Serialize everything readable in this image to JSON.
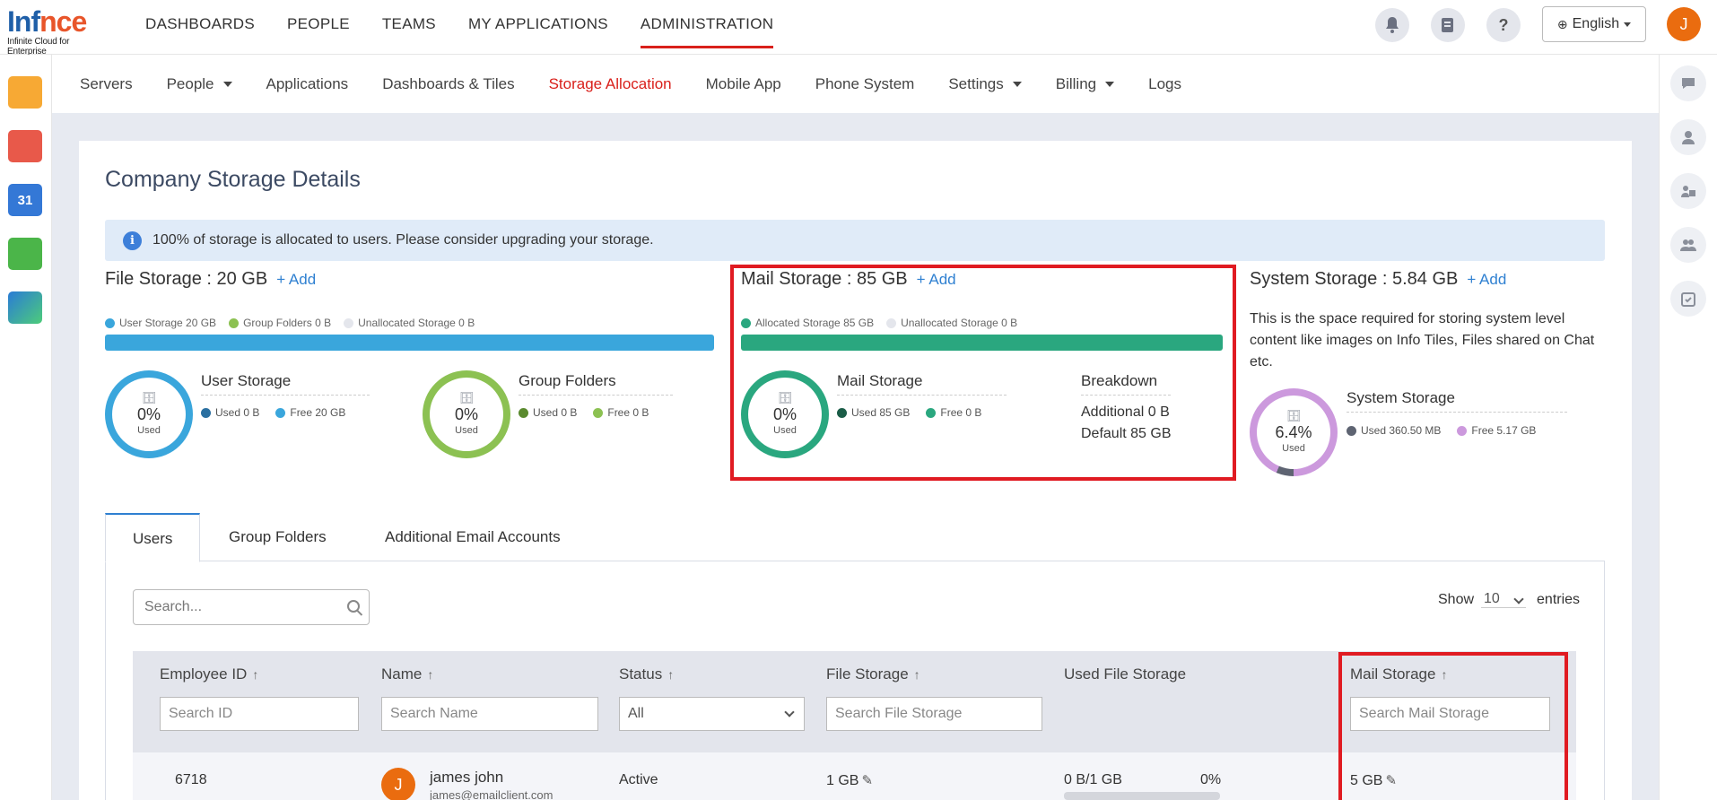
{
  "logo": {
    "name": "Infince",
    "name_a": "Inf",
    "name_b": "nce",
    "tagline": "Infinite Cloud for Enterprise"
  },
  "topnav": [
    "DASHBOARDS",
    "PEOPLE",
    "TEAMS",
    "MY APPLICATIONS",
    "ADMINISTRATION"
  ],
  "topnav_active": "ADMINISTRATION",
  "language": "English",
  "user_initial": "J",
  "subnav": [
    {
      "label": "Servers",
      "dropdown": false
    },
    {
      "label": "People",
      "dropdown": true
    },
    {
      "label": "Applications",
      "dropdown": false
    },
    {
      "label": "Dashboards & Tiles",
      "dropdown": false
    },
    {
      "label": "Storage Allocation",
      "dropdown": false,
      "active": true
    },
    {
      "label": "Mobile App",
      "dropdown": false
    },
    {
      "label": "Phone System",
      "dropdown": false
    },
    {
      "label": "Settings",
      "dropdown": true
    },
    {
      "label": "Billing",
      "dropdown": true
    },
    {
      "label": "Logs",
      "dropdown": false
    }
  ],
  "page_title": "Company Storage Details",
  "alert": "100% of storage is allocated to users. Please consider upgrading your storage.",
  "add_label": "+ Add",
  "file_storage": {
    "title": "File Storage : 20 GB",
    "legend": [
      "User Storage 20 GB",
      "Group Folders 0 B",
      "Unallocated Storage 0 B"
    ],
    "user": {
      "title": "User Storage",
      "pct": "0%",
      "used_label": "Used",
      "used": "Used 0 B",
      "free": "Free 20 GB",
      "used_fraction": 0
    },
    "group": {
      "title": "Group Folders",
      "pct": "0%",
      "used_label": "Used",
      "used": "Used 0 B",
      "free": "Free 0 B",
      "used_fraction": 0
    }
  },
  "mail_storage": {
    "title": "Mail Storage : 85 GB",
    "legend": [
      "Allocated Storage 85 GB",
      "Unallocated Storage 0 B"
    ],
    "donut": {
      "title": "Mail Storage",
      "pct": "0%",
      "used_label": "Used",
      "used": "Used 85 GB",
      "free": "Free 0 B",
      "used_fraction": 0
    },
    "breakdown_title": "Breakdown",
    "breakdown": [
      "Additional 0 B",
      "Default 85 GB"
    ]
  },
  "system_storage": {
    "title": "System Storage : 5.84 GB",
    "description": "This is the space required for storing system level content like images on Info Tiles, Files shared on Chat etc.",
    "donut": {
      "title": "System Storage",
      "pct": "6.4%",
      "used_label": "Used",
      "used": "Used 360.50 MB",
      "free": "Free 5.17 GB",
      "used_fraction": 0.064
    }
  },
  "tabs": [
    "Users",
    "Group Folders",
    "Additional Email Accounts"
  ],
  "search_placeholder": "Search...",
  "show": {
    "label": "Show",
    "value": "10",
    "suffix": "entries"
  },
  "columns": {
    "employee_id": "Employee ID",
    "name": "Name",
    "status": "Status",
    "file_storage": "File Storage",
    "used_file_storage": "Used File Storage",
    "mail_storage": "Mail Storage"
  },
  "filters": {
    "employee_id": "Search ID",
    "name": "Search Name",
    "status": "All",
    "file_storage": "Search File Storage",
    "mail_storage": "Search Mail Storage"
  },
  "rows": [
    {
      "employee_id": "6718",
      "initial": "J",
      "name": "james john",
      "email": "james@emailclient.com",
      "status": "Active",
      "file_storage": "1 GB",
      "used_file_storage": "0 B/1 GB",
      "used_pct": "0%",
      "mail_storage": "5 GB"
    }
  ],
  "colors": {
    "accent_red": "#d9201b",
    "user_blue": "#3aa6dc",
    "group_green": "#8cc152",
    "mail_teal": "#2aa77f",
    "system_purple": "#cc99dd",
    "link_blue": "#2f80d1"
  }
}
